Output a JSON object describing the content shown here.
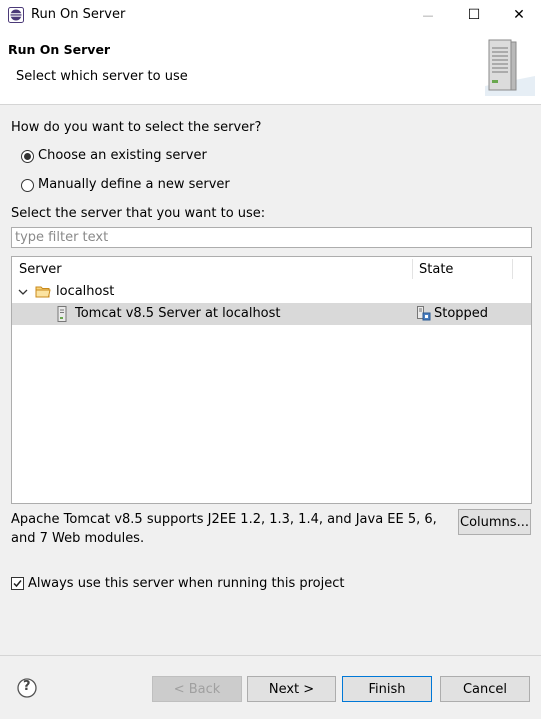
{
  "window": {
    "title": "Run On Server",
    "minimize_glyph": "—",
    "maximize_glyph": "☐",
    "close_glyph": "✕"
  },
  "header": {
    "title": "Run On Server",
    "description": "Select which server to use",
    "icon": "server-tower-icon"
  },
  "selection": {
    "question": "How do you want to select the server?",
    "options": [
      {
        "label": "Choose an existing server",
        "checked": true
      },
      {
        "label": "Manually define a new server",
        "checked": false
      }
    ],
    "list_label": "Select the server that you want to use:",
    "filter_placeholder": "type filter text",
    "filter_value": ""
  },
  "server_tree": {
    "columns": [
      "Server",
      "State"
    ],
    "group": {
      "label": "localhost",
      "expanded": true,
      "icon": "folder-icon"
    },
    "servers": [
      {
        "name": "Tomcat v8.5 Server at localhost",
        "state": "Stopped",
        "selected": true
      }
    ]
  },
  "details": {
    "description": "Apache Tomcat v8.5 supports J2EE 1.2, 1.3, 1.4, and Java EE 5, 6, and 7 Web modules.",
    "columns_button": "Columns..."
  },
  "always_use": {
    "label": "Always use this server when running this project",
    "checked": true
  },
  "footer": {
    "back": "< Back",
    "next": "Next >",
    "finish": "Finish",
    "cancel": "Cancel",
    "help_glyph": "?"
  },
  "colors": {
    "selection_bg": "#d9d9d9",
    "default_button_border": "#0078d7",
    "folder": "#e8a33a"
  }
}
